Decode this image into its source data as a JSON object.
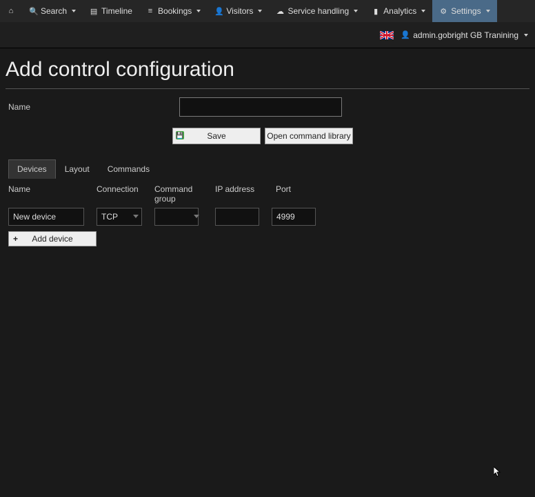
{
  "nav": {
    "home": "",
    "search": "Search",
    "timeline": "Timeline",
    "bookings": "Bookings",
    "visitors": "Visitors",
    "service": "Service handling",
    "analytics": "Analytics",
    "settings": "Settings"
  },
  "user": {
    "name": "admin.gobright GB Tranining"
  },
  "page": {
    "title": "Add control configuration",
    "name_label": "Name",
    "name_value": ""
  },
  "buttons": {
    "save": "Save",
    "open_library": "Open command library",
    "add_device": "Add device"
  },
  "tabs": {
    "devices": "Devices",
    "layout": "Layout",
    "commands": "Commands"
  },
  "grid": {
    "columns": {
      "name": "Name",
      "connection": "Connection",
      "command_group": "Command group",
      "ip": "IP address",
      "port": "Port"
    },
    "row": {
      "name": "New device",
      "connection": "TCP",
      "command_group": "",
      "ip": "",
      "port": "4999"
    }
  }
}
